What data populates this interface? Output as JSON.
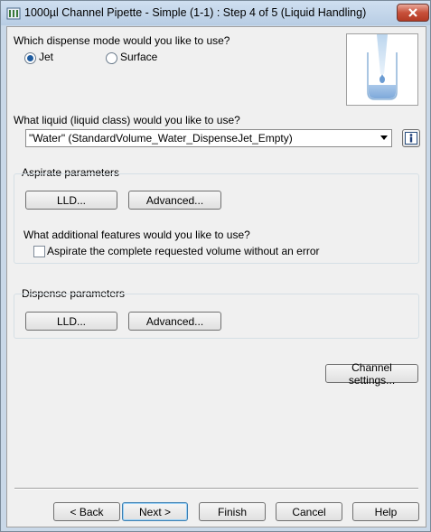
{
  "window": {
    "title": "1000µl Channel Pipette - Simple (1-1) : Step 4 of 5 (Liquid Handling)"
  },
  "dispense_mode": {
    "question": "Which dispense mode would you like to use?",
    "options": [
      {
        "label": "Jet",
        "selected": true
      },
      {
        "label": "Surface",
        "selected": false
      }
    ]
  },
  "liquid": {
    "question": "What liquid (liquid class) would you like to use?",
    "value": "\"Water\"  (StandardVolume_Water_DispenseJet_Empty)"
  },
  "aspirate": {
    "title": "Aspirate parameters",
    "lld_label": "LLD...",
    "advanced_label": "Advanced...",
    "features_question": "What additional features would you like to use?",
    "complete_volume_label": "Aspirate the complete requested volume without an error",
    "complete_volume_checked": false
  },
  "dispense": {
    "title": "Dispense parameters",
    "lld_label": "LLD...",
    "advanced_label": "Advanced..."
  },
  "channel_settings_label": "Channel settings...",
  "footer": {
    "back_label": "< Back",
    "next_label": "Next >",
    "finish_label": "Finish",
    "cancel_label": "Cancel",
    "help_label": "Help"
  }
}
